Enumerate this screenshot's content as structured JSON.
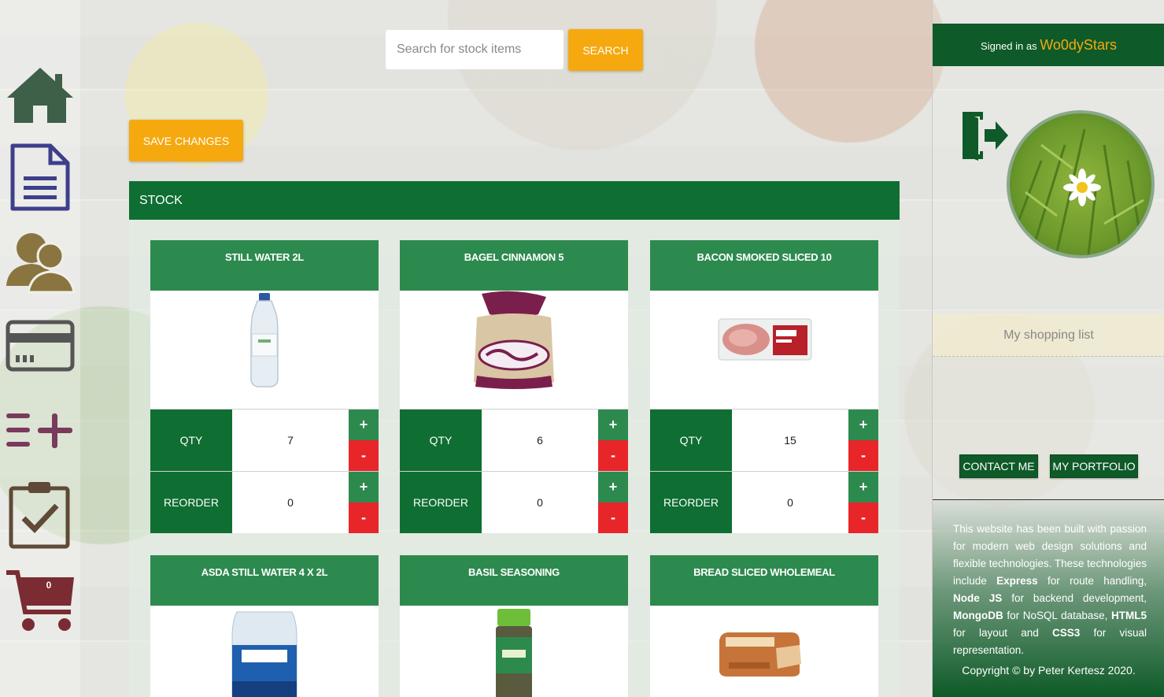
{
  "search": {
    "placeholder": "Search for stock items",
    "button_label": "SEARCH"
  },
  "actions": {
    "save_label": "SAVE CHANGES"
  },
  "stock": {
    "header": "STOCK",
    "qty_label": "QTY",
    "reorder_label": "REORDER",
    "plus_label": "+",
    "minus_label": "-",
    "items": [
      {
        "name": "STILL WATER 2L",
        "qty": "7",
        "reorder": "0",
        "image": "water-bottle"
      },
      {
        "name": "BAGEL CINNAMON 5",
        "qty": "6",
        "reorder": "0",
        "image": "bagel-bag"
      },
      {
        "name": "BACON SMOKED SLICED 10",
        "qty": "15",
        "reorder": "0",
        "image": "bacon-pack"
      },
      {
        "name": "ASDA STILL WATER 4 X 2L",
        "image": "water-multipack"
      },
      {
        "name": "BASIL SEASONING",
        "image": "basil-jar"
      },
      {
        "name": "BREAD SLICED WHOLEMEAL",
        "image": "bread-loaf"
      }
    ]
  },
  "nav": {
    "items": [
      "home-icon",
      "document-icon",
      "users-icon",
      "card-icon",
      "add-list-icon",
      "clipboard-check-icon",
      "cart-icon"
    ],
    "cart_count": "0"
  },
  "user": {
    "signed_in_prefix": "Signed in as",
    "username": "Wo0dyStars"
  },
  "sidebar": {
    "shopping_list_label": "My shopping list",
    "contact_label": "CONTACT ME",
    "portfolio_label": "MY PORTFOLIO"
  },
  "footer": {
    "t1": "This website has been built with passion for modern web design solutions and flexible technologies. These technologies include",
    "t2": "Express",
    "t3": "for route handling,",
    "t4": "Node JS",
    "t5": "for backend development,",
    "t6": "MongoDB",
    "t7": "for NoSQL database,",
    "t8": "HTML5",
    "t9": "for layout and",
    "t10": "CSS3",
    "t11": "for visual representation.",
    "copyright": "Copyright © by Peter Kertesz 2020."
  },
  "colors": {
    "brand_green": "#0f6e32",
    "card_green": "#2d8a4e",
    "accent_orange": "#f5a90f",
    "danger_red": "#e8262a"
  }
}
